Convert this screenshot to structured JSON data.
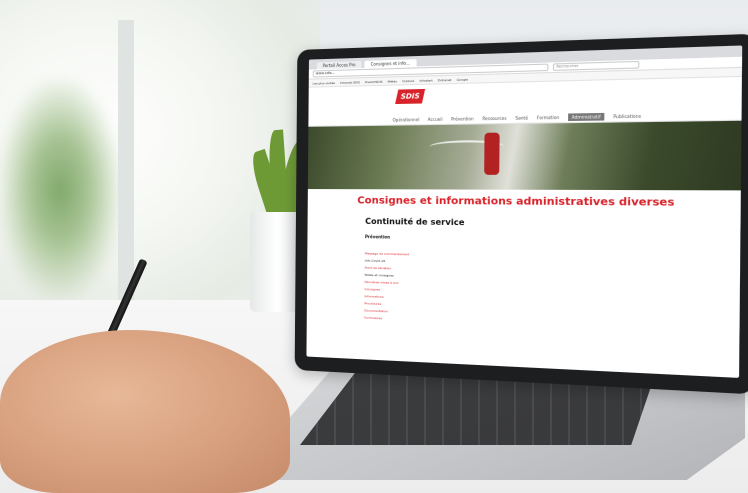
{
  "browser": {
    "tabs": [
      {
        "label": "Portail Acces Pro",
        "active": false
      },
      {
        "label": "Consignes et info...",
        "active": true
      }
    ],
    "url": "www.sdis...",
    "search_placeholder": "Rechercher",
    "bookmarks": [
      "Les plus visités",
      "Intranet SDIS",
      "PredictSDIS",
      "Météo",
      "Outlook",
      "Infostart",
      "Extranet",
      "Google"
    ]
  },
  "site": {
    "logo_text": "SDIS",
    "nav": [
      {
        "label": "Opérationnel",
        "active": false
      },
      {
        "label": "Accueil",
        "active": false
      },
      {
        "label": "Prévention",
        "active": false
      },
      {
        "label": "Ressources",
        "active": false
      },
      {
        "label": "Santé",
        "active": false
      },
      {
        "label": "Formation",
        "active": false
      },
      {
        "label": "Administratif",
        "active": true
      },
      {
        "label": "Publications",
        "active": false
      }
    ],
    "page_title": "Consignes et informations administratives diverses",
    "page_date": "",
    "section_title": "Continuité de service",
    "section_sub": "Prévention",
    "items": [
      {
        "link": "Message de commandement",
        "text": ""
      },
      {
        "link": "",
        "text": "Info Covid-19"
      },
      {
        "link": "Point de situation",
        "text": ""
      },
      {
        "link": "",
        "text": "Notes et consignes"
      },
      {
        "link": "Dernières mises à jour",
        "text": ""
      },
      {
        "link": "Consignes",
        "text": ""
      },
      {
        "link": "Informations",
        "text": ""
      },
      {
        "link": "Procédures",
        "text": ""
      },
      {
        "link": "Documentation",
        "text": ""
      },
      {
        "link": "Formulaires",
        "text": ""
      }
    ]
  },
  "colors": {
    "brand_red": "#d8232a",
    "laptop_bezel": "#1d1e20"
  }
}
